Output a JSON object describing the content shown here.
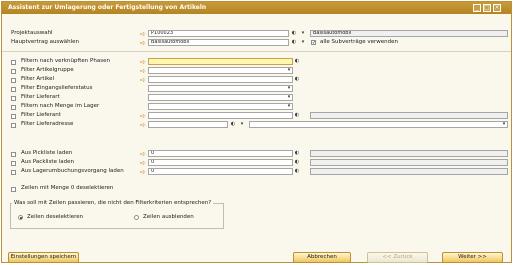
{
  "window": {
    "title": "Assistent zur Umlagerung oder Fertigstellung von Artikeln",
    "controls": [
      "_",
      "□",
      "×"
    ]
  },
  "header": {
    "project_label": "Projektauswahl",
    "project_value": "P100023",
    "project_desc": "Basisautomobil",
    "main_contract_label": "Hauptvertrag auswählen",
    "main_contract_value": "Basisautomobil",
    "all_subcontracts_label": "alle Subverträge verwenden",
    "all_subcontracts_checked": true
  },
  "filters": [
    {
      "label": "Filtern nach verknüpften Phasen",
      "type": "yellow"
    },
    {
      "label": "Filter Artikelgruppe",
      "type": "normal"
    },
    {
      "label": "Filter Artikel",
      "type": "normal"
    },
    {
      "label": "Filter Eingangslieferstatus",
      "type": "normal"
    },
    {
      "label": "Filter Lieferart",
      "type": "normal"
    },
    {
      "label": "Filtern nach Menge im Lager",
      "type": "normal"
    },
    {
      "label": "Filter Lieferant",
      "type": "normal"
    },
    {
      "label": "Filter Lieferadresse",
      "type": "normal"
    }
  ],
  "picklists": [
    {
      "label": "Aus Pickliste laden",
      "value": "0"
    },
    {
      "label": "Aus Packliste laden",
      "value": "0"
    },
    {
      "label": "Aus Lagerumbuchungsvorgang laden",
      "value": "0"
    }
  ],
  "zero_rows_label": "Zeilen mit Menge 0 deselektieren",
  "nonmatch": {
    "legend": "Was soll mit Zeilen passieren, die nicht den Filterkriterien entsprechen?",
    "option_deselect": "Zeilen deselektieren",
    "option_hide": "Zeilen ausblenden",
    "selected": "deselect"
  },
  "buttons": {
    "save_settings": "Einstellungen speichern",
    "cancel": "Abbrechen",
    "back": "<< Zurück",
    "next": "Weiter >>"
  },
  "colors": {
    "accent": "#c89a39",
    "highlight": "#fff7b0"
  }
}
